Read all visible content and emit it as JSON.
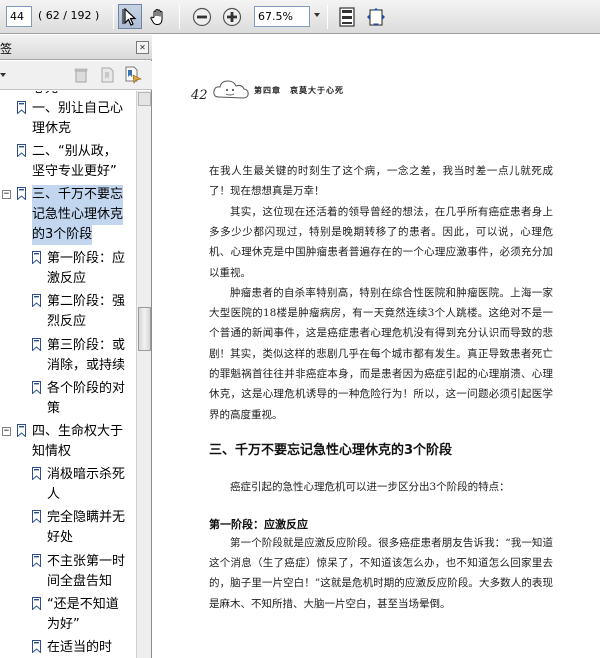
{
  "toolbar": {
    "page_current": "44",
    "page_info": "( 62 / 192 )",
    "zoom": "67.5%"
  },
  "sidebar": {
    "title": "签",
    "close_glyph": "✕",
    "expander_minus": "−",
    "items": [
      {
        "lines": [
          "一、别让自己心",
          "理休克"
        ]
      },
      {
        "lines": [
          "二、“别从政，",
          "坚守专业更好”"
        ]
      },
      {
        "lines": [
          "三、千万不要忘",
          "记急性心理休克",
          "的3个阶段"
        ]
      },
      {
        "lines": [
          "第一阶段：应",
          "激反应"
        ]
      },
      {
        "lines": [
          "第二阶段：强",
          "烈反应"
        ]
      },
      {
        "lines": [
          "第三阶段：或",
          "消除，或持续"
        ]
      },
      {
        "lines": [
          "各个阶段的对",
          "策"
        ]
      },
      {
        "lines": [
          "四、生命权大于",
          "知情权"
        ]
      },
      {
        "lines": [
          "消极暗示杀死",
          "人"
        ]
      },
      {
        "lines": [
          "完全隐瞒并无",
          "好处"
        ]
      },
      {
        "lines": [
          "不主张第一时",
          "间全盘告知"
        ]
      },
      {
        "lines": [
          "“还是不知道",
          "为好”"
        ]
      },
      {
        "lines": [
          "在适当的时"
        ]
      }
    ]
  },
  "document": {
    "page_number": "42",
    "chapter_header": "第四章　哀莫大于心死",
    "paragraphs": [
      "在我人生最关键的时刻生了这个病，一念之差，我当时差一点儿就死成了！现在想想真是万幸！",
      "其实，这位现在还活着的领导曾经的想法，在几乎所有癌症患者身上多多少少都闪现过，特别是晚期转移了的患者。因此，可以说，心理危机、心理休克是中国肿瘤患者普遍存在的一个心理应激事件，必须充分加以重视。",
      "肿瘤患者的自杀率特别高，特别在综合性医院和肿瘤医院。上海一家大型医院的18楼是肿瘤病房，有一天竟然连续3个人跳楼。这绝对不是一个普通的新闻事件，这是癌症患者心理危机没有得到充分认识而导致的悲剧！",
      "其实，类似这样的悲剧几乎在每个城市都有发生。真正导致患者死亡的罪魁祸首往往并非癌症本身，而是患者因为癌症引起的心理崩溃、心理休克，这是心理危机诱导的一种危险行为！所以，这一问题必须引起医学界的高度重视。"
    ],
    "section_title": "三、千万不要忘记急性心理休克的3个阶段",
    "section_intro": "癌症引起的急性心理危机可以进一步区分出3个阶段的特点：",
    "stage_title": "第一阶段：应激反应",
    "stage_para": "第一个阶段就是应激反应阶段。很多癌症患者朋友告诉我：“我一知道这个消息（生了癌症）惊呆了，不知道该怎么办，也不知道怎么回家里去的，脑子里一片空白！”这就是危机时期的应激反应阶段。大多数人的表现是麻木、不知所措、大脑一片空白，甚至当场晕倒。"
  }
}
